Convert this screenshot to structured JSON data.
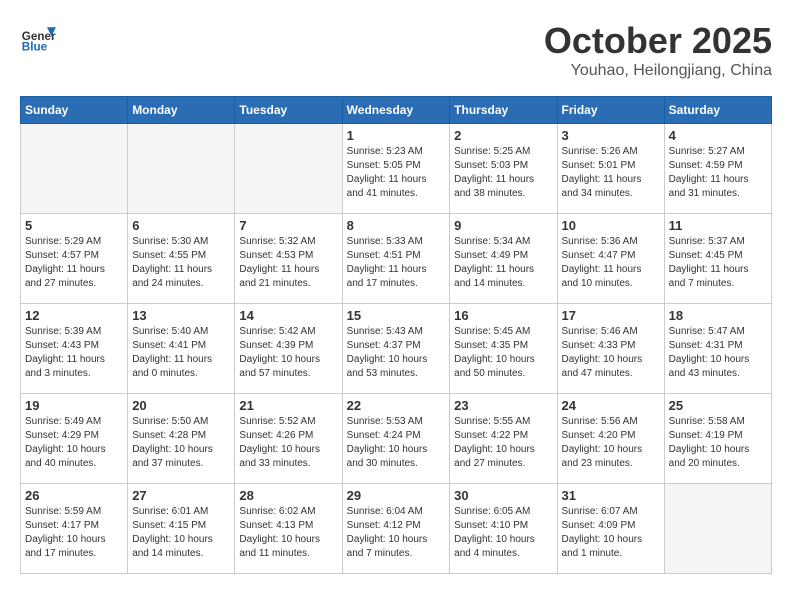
{
  "header": {
    "logo_general": "General",
    "logo_blue": "Blue",
    "month_title": "October 2025",
    "location": "Youhao, Heilongjiang, China"
  },
  "weekdays": [
    "Sunday",
    "Monday",
    "Tuesday",
    "Wednesday",
    "Thursday",
    "Friday",
    "Saturday"
  ],
  "weeks": [
    [
      {
        "day": "",
        "empty": true
      },
      {
        "day": "",
        "empty": true
      },
      {
        "day": "",
        "empty": true
      },
      {
        "day": "1",
        "sunrise": "5:23 AM",
        "sunset": "5:05 PM",
        "daylight": "11 hours and 41 minutes."
      },
      {
        "day": "2",
        "sunrise": "5:25 AM",
        "sunset": "5:03 PM",
        "daylight": "11 hours and 38 minutes."
      },
      {
        "day": "3",
        "sunrise": "5:26 AM",
        "sunset": "5:01 PM",
        "daylight": "11 hours and 34 minutes."
      },
      {
        "day": "4",
        "sunrise": "5:27 AM",
        "sunset": "4:59 PM",
        "daylight": "11 hours and 31 minutes."
      }
    ],
    [
      {
        "day": "5",
        "sunrise": "5:29 AM",
        "sunset": "4:57 PM",
        "daylight": "11 hours and 27 minutes."
      },
      {
        "day": "6",
        "sunrise": "5:30 AM",
        "sunset": "4:55 PM",
        "daylight": "11 hours and 24 minutes."
      },
      {
        "day": "7",
        "sunrise": "5:32 AM",
        "sunset": "4:53 PM",
        "daylight": "11 hours and 21 minutes."
      },
      {
        "day": "8",
        "sunrise": "5:33 AM",
        "sunset": "4:51 PM",
        "daylight": "11 hours and 17 minutes."
      },
      {
        "day": "9",
        "sunrise": "5:34 AM",
        "sunset": "4:49 PM",
        "daylight": "11 hours and 14 minutes."
      },
      {
        "day": "10",
        "sunrise": "5:36 AM",
        "sunset": "4:47 PM",
        "daylight": "11 hours and 10 minutes."
      },
      {
        "day": "11",
        "sunrise": "5:37 AM",
        "sunset": "4:45 PM",
        "daylight": "11 hours and 7 minutes."
      }
    ],
    [
      {
        "day": "12",
        "sunrise": "5:39 AM",
        "sunset": "4:43 PM",
        "daylight": "11 hours and 3 minutes."
      },
      {
        "day": "13",
        "sunrise": "5:40 AM",
        "sunset": "4:41 PM",
        "daylight": "11 hours and 0 minutes."
      },
      {
        "day": "14",
        "sunrise": "5:42 AM",
        "sunset": "4:39 PM",
        "daylight": "10 hours and 57 minutes."
      },
      {
        "day": "15",
        "sunrise": "5:43 AM",
        "sunset": "4:37 PM",
        "daylight": "10 hours and 53 minutes."
      },
      {
        "day": "16",
        "sunrise": "5:45 AM",
        "sunset": "4:35 PM",
        "daylight": "10 hours and 50 minutes."
      },
      {
        "day": "17",
        "sunrise": "5:46 AM",
        "sunset": "4:33 PM",
        "daylight": "10 hours and 47 minutes."
      },
      {
        "day": "18",
        "sunrise": "5:47 AM",
        "sunset": "4:31 PM",
        "daylight": "10 hours and 43 minutes."
      }
    ],
    [
      {
        "day": "19",
        "sunrise": "5:49 AM",
        "sunset": "4:29 PM",
        "daylight": "10 hours and 40 minutes."
      },
      {
        "day": "20",
        "sunrise": "5:50 AM",
        "sunset": "4:28 PM",
        "daylight": "10 hours and 37 minutes."
      },
      {
        "day": "21",
        "sunrise": "5:52 AM",
        "sunset": "4:26 PM",
        "daylight": "10 hours and 33 minutes."
      },
      {
        "day": "22",
        "sunrise": "5:53 AM",
        "sunset": "4:24 PM",
        "daylight": "10 hours and 30 minutes."
      },
      {
        "day": "23",
        "sunrise": "5:55 AM",
        "sunset": "4:22 PM",
        "daylight": "10 hours and 27 minutes."
      },
      {
        "day": "24",
        "sunrise": "5:56 AM",
        "sunset": "4:20 PM",
        "daylight": "10 hours and 23 minutes."
      },
      {
        "day": "25",
        "sunrise": "5:58 AM",
        "sunset": "4:19 PM",
        "daylight": "10 hours and 20 minutes."
      }
    ],
    [
      {
        "day": "26",
        "sunrise": "5:59 AM",
        "sunset": "4:17 PM",
        "daylight": "10 hours and 17 minutes."
      },
      {
        "day": "27",
        "sunrise": "6:01 AM",
        "sunset": "4:15 PM",
        "daylight": "10 hours and 14 minutes."
      },
      {
        "day": "28",
        "sunrise": "6:02 AM",
        "sunset": "4:13 PM",
        "daylight": "10 hours and 11 minutes."
      },
      {
        "day": "29",
        "sunrise": "6:04 AM",
        "sunset": "4:12 PM",
        "daylight": "10 hours and 7 minutes."
      },
      {
        "day": "30",
        "sunrise": "6:05 AM",
        "sunset": "4:10 PM",
        "daylight": "10 hours and 4 minutes."
      },
      {
        "day": "31",
        "sunrise": "6:07 AM",
        "sunset": "4:09 PM",
        "daylight": "10 hours and 1 minute."
      },
      {
        "day": "",
        "empty": true
      }
    ]
  ]
}
